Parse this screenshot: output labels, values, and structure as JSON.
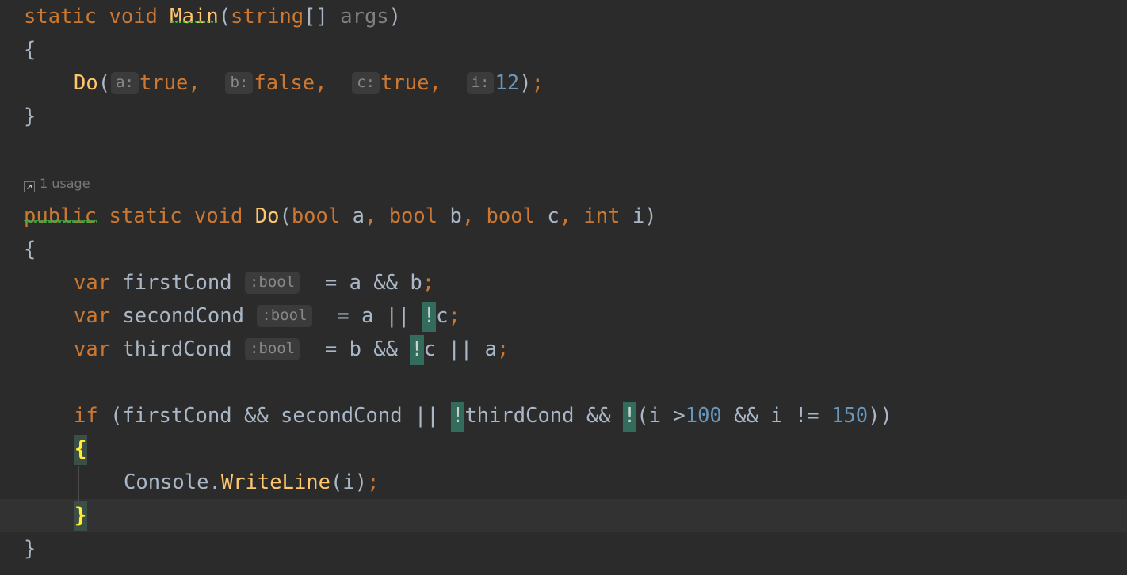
{
  "editor": {
    "language": "csharp",
    "theme": "darcula",
    "background": "#2b2b2b",
    "caret_line_background": "#323232",
    "colors": {
      "keyword": "#cc7832",
      "identifier": "#a9b7c6",
      "method": "#ffc66d",
      "number": "#6897bb",
      "dimmed": "#808080",
      "inlay_hint_bg": "#3b3b3b",
      "inlay_hint_fg": "#888888",
      "negation_highlight_bg": "#336b5c",
      "brace_highlight_bg": "#3c4f47",
      "brace_highlight_fg": "#ffee34",
      "warning_squiggle": "#46a546",
      "indent_guide": "#4b4b4b"
    }
  },
  "usage_inlay": {
    "icon": "usage-arrow-icon",
    "label": "1 usage"
  },
  "code": {
    "line1": {
      "kw_static": "static",
      "kw_void": "void",
      "name_main": "Main",
      "paren_open": "(",
      "kw_string": "string",
      "brackets": "[]",
      "args": "args",
      "paren_close": ")"
    },
    "line2": {
      "brace": "{"
    },
    "line3": {
      "call": "Do",
      "paren_open": "(",
      "hint_a": "a:",
      "val_a": "true",
      "comma1": ",",
      "hint_b": "b:",
      "val_b": "false",
      "comma2": ",",
      "hint_c": "c:",
      "val_c": "true",
      "comma3": ",",
      "hint_i": "i:",
      "val_i": "12",
      "paren_close": ")",
      "semi": ";"
    },
    "line4": {
      "brace": "}"
    },
    "line6": {
      "kw_public": "public",
      "kw_static": "static",
      "kw_void": "void",
      "name_do": "Do",
      "paren_open": "(",
      "p1_type": "bool",
      "p1_name": "a",
      "c1": ",",
      "p2_type": "bool",
      "p2_name": "b",
      "c2": ",",
      "p3_type": "bool",
      "p3_name": "c",
      "c3": ",",
      "p4_type": "int",
      "p4_name": "i",
      "paren_close": ")"
    },
    "line7": {
      "brace": "{"
    },
    "line8": {
      "kw_var": "var",
      "name": "firstCond",
      "type_hint": ":bool",
      "eq": "=",
      "expr": "a && b",
      "semi": ";"
    },
    "line9": {
      "kw_var": "var",
      "name": "secondCond",
      "type_hint": ":bool",
      "eq": "=",
      "lhs": "a ||",
      "bang": "!",
      "rhs": "c",
      "semi": ";"
    },
    "line10": {
      "kw_var": "var",
      "name": "thirdCond",
      "type_hint": ":bool",
      "eq": "=",
      "lhs": "b &&",
      "bang": "!",
      "mid": "c || a",
      "semi": ";"
    },
    "line12": {
      "kw_if": "if",
      "paren_open": "(",
      "cond1": "firstCond && secondCond ||",
      "bang1": "!",
      "cond2": "thirdCond &&",
      "bang2": "!",
      "inner_open": "(",
      "var_i": "i",
      "gt": ">",
      "num100": "100",
      "and": "&&",
      "var_i2": "i",
      "neq": "!=",
      "num150": "150",
      "inner_close": ")",
      "paren_close": ")"
    },
    "line13": {
      "brace": "{"
    },
    "line14": {
      "obj": "Console",
      "dot": ".",
      "method": "WriteLine",
      "paren_open": "(",
      "arg": "i",
      "paren_close": ")",
      "semi": ";"
    },
    "line15": {
      "brace": "}"
    },
    "line16": {
      "brace": "}"
    }
  }
}
